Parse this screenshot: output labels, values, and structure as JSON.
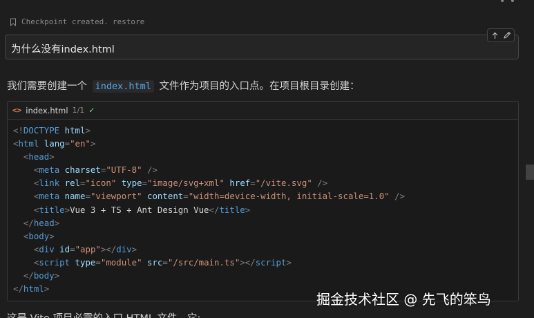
{
  "checkpoint": {
    "text": "Checkpoint created.",
    "restore": "restore",
    "icon": "bookmark-icon"
  },
  "user_message": {
    "text": "为什么没有index.html",
    "actions": [
      "arrow-up-icon",
      "pencil-icon"
    ]
  },
  "reply": {
    "before": "我们需要创建一个",
    "code": "index.html",
    "after": "文件作为项目的入口点。在项目根目录创建："
  },
  "code_block": {
    "icon": "code-icon",
    "icon_glyph": "<>",
    "filename": "index.html",
    "count": "1/1",
    "check": "✓",
    "lines": [
      [
        {
          "t": "punc",
          "v": "<!"
        },
        {
          "t": "tag",
          "v": "DOCTYPE"
        },
        {
          "t": "text",
          "v": " "
        },
        {
          "t": "attr",
          "v": "html"
        },
        {
          "t": "punc",
          "v": ">"
        }
      ],
      [
        {
          "t": "punc",
          "v": "<"
        },
        {
          "t": "tag",
          "v": "html"
        },
        {
          "t": "text",
          "v": " "
        },
        {
          "t": "attr",
          "v": "lang"
        },
        {
          "t": "punc",
          "v": "="
        },
        {
          "t": "str",
          "v": "\"en\""
        },
        {
          "t": "punc",
          "v": ">"
        }
      ],
      [
        {
          "t": "text",
          "v": "  "
        },
        {
          "t": "punc",
          "v": "<"
        },
        {
          "t": "tag",
          "v": "head"
        },
        {
          "t": "punc",
          "v": ">"
        }
      ],
      [
        {
          "t": "text",
          "v": "    "
        },
        {
          "t": "punc",
          "v": "<"
        },
        {
          "t": "tag",
          "v": "meta"
        },
        {
          "t": "text",
          "v": " "
        },
        {
          "t": "attr",
          "v": "charset"
        },
        {
          "t": "punc",
          "v": "="
        },
        {
          "t": "str",
          "v": "\"UTF-8\""
        },
        {
          "t": "text",
          "v": " "
        },
        {
          "t": "punc",
          "v": "/>"
        }
      ],
      [
        {
          "t": "text",
          "v": "    "
        },
        {
          "t": "punc",
          "v": "<"
        },
        {
          "t": "tag",
          "v": "link"
        },
        {
          "t": "text",
          "v": " "
        },
        {
          "t": "attr",
          "v": "rel"
        },
        {
          "t": "punc",
          "v": "="
        },
        {
          "t": "str",
          "v": "\"icon\""
        },
        {
          "t": "text",
          "v": " "
        },
        {
          "t": "attr",
          "v": "type"
        },
        {
          "t": "punc",
          "v": "="
        },
        {
          "t": "str",
          "v": "\"image/svg+xml\""
        },
        {
          "t": "text",
          "v": " "
        },
        {
          "t": "attr",
          "v": "href"
        },
        {
          "t": "punc",
          "v": "="
        },
        {
          "t": "str",
          "v": "\"/vite.svg\""
        },
        {
          "t": "text",
          "v": " "
        },
        {
          "t": "punc",
          "v": "/>"
        }
      ],
      [
        {
          "t": "text",
          "v": "    "
        },
        {
          "t": "punc",
          "v": "<"
        },
        {
          "t": "tag",
          "v": "meta"
        },
        {
          "t": "text",
          "v": " "
        },
        {
          "t": "attr",
          "v": "name"
        },
        {
          "t": "punc",
          "v": "="
        },
        {
          "t": "str",
          "v": "\"viewport\""
        },
        {
          "t": "text",
          "v": " "
        },
        {
          "t": "attr",
          "v": "content"
        },
        {
          "t": "punc",
          "v": "="
        },
        {
          "t": "str",
          "v": "\"width=device-width, initial-scale=1.0\""
        },
        {
          "t": "text",
          "v": " "
        },
        {
          "t": "punc",
          "v": "/>"
        }
      ],
      [
        {
          "t": "text",
          "v": "    "
        },
        {
          "t": "punc",
          "v": "<"
        },
        {
          "t": "tag",
          "v": "title"
        },
        {
          "t": "punc",
          "v": ">"
        },
        {
          "t": "text",
          "v": "Vue 3 + TS + Ant Design Vue"
        },
        {
          "t": "punc",
          "v": "</"
        },
        {
          "t": "tag",
          "v": "title"
        },
        {
          "t": "punc",
          "v": ">"
        }
      ],
      [
        {
          "t": "text",
          "v": "  "
        },
        {
          "t": "punc",
          "v": "</"
        },
        {
          "t": "tag",
          "v": "head"
        },
        {
          "t": "punc",
          "v": ">"
        }
      ],
      [
        {
          "t": "text",
          "v": "  "
        },
        {
          "t": "punc",
          "v": "<"
        },
        {
          "t": "tag",
          "v": "body"
        },
        {
          "t": "punc",
          "v": ">"
        }
      ],
      [
        {
          "t": "text",
          "v": "    "
        },
        {
          "t": "punc",
          "v": "<"
        },
        {
          "t": "tag",
          "v": "div"
        },
        {
          "t": "text",
          "v": " "
        },
        {
          "t": "attr",
          "v": "id"
        },
        {
          "t": "punc",
          "v": "="
        },
        {
          "t": "str",
          "v": "\"app\""
        },
        {
          "t": "punc",
          "v": "></"
        },
        {
          "t": "tag",
          "v": "div"
        },
        {
          "t": "punc",
          "v": ">"
        }
      ],
      [
        {
          "t": "text",
          "v": "    "
        },
        {
          "t": "punc",
          "v": "<"
        },
        {
          "t": "tag",
          "v": "script"
        },
        {
          "t": "text",
          "v": " "
        },
        {
          "t": "attr",
          "v": "type"
        },
        {
          "t": "punc",
          "v": "="
        },
        {
          "t": "str",
          "v": "\"module\""
        },
        {
          "t": "text",
          "v": " "
        },
        {
          "t": "attr",
          "v": "src"
        },
        {
          "t": "punc",
          "v": "="
        },
        {
          "t": "str",
          "v": "\"/src/main.ts\""
        },
        {
          "t": "punc",
          "v": "></"
        },
        {
          "t": "tag",
          "v": "script"
        },
        {
          "t": "punc",
          "v": ">"
        }
      ],
      [
        {
          "t": "text",
          "v": "  "
        },
        {
          "t": "punc",
          "v": "</"
        },
        {
          "t": "tag",
          "v": "body"
        },
        {
          "t": "punc",
          "v": ">"
        }
      ],
      [
        {
          "t": "punc",
          "v": "</"
        },
        {
          "t": "tag",
          "v": "html"
        },
        {
          "t": "punc",
          "v": ">"
        }
      ]
    ]
  },
  "watermark": "掘金技术社区 @ 先飞的笨鸟",
  "truncated_line": "这是 Vite 项目必需的入口 HTML 文件。它:",
  "colors": {
    "background": "#1e1e1e",
    "tag": "#569cd6",
    "attribute": "#9cdcfe",
    "string": "#ce9178",
    "inline_code": "#4fa8f0",
    "file_icon": "#e8804f",
    "check": "#89d185"
  }
}
